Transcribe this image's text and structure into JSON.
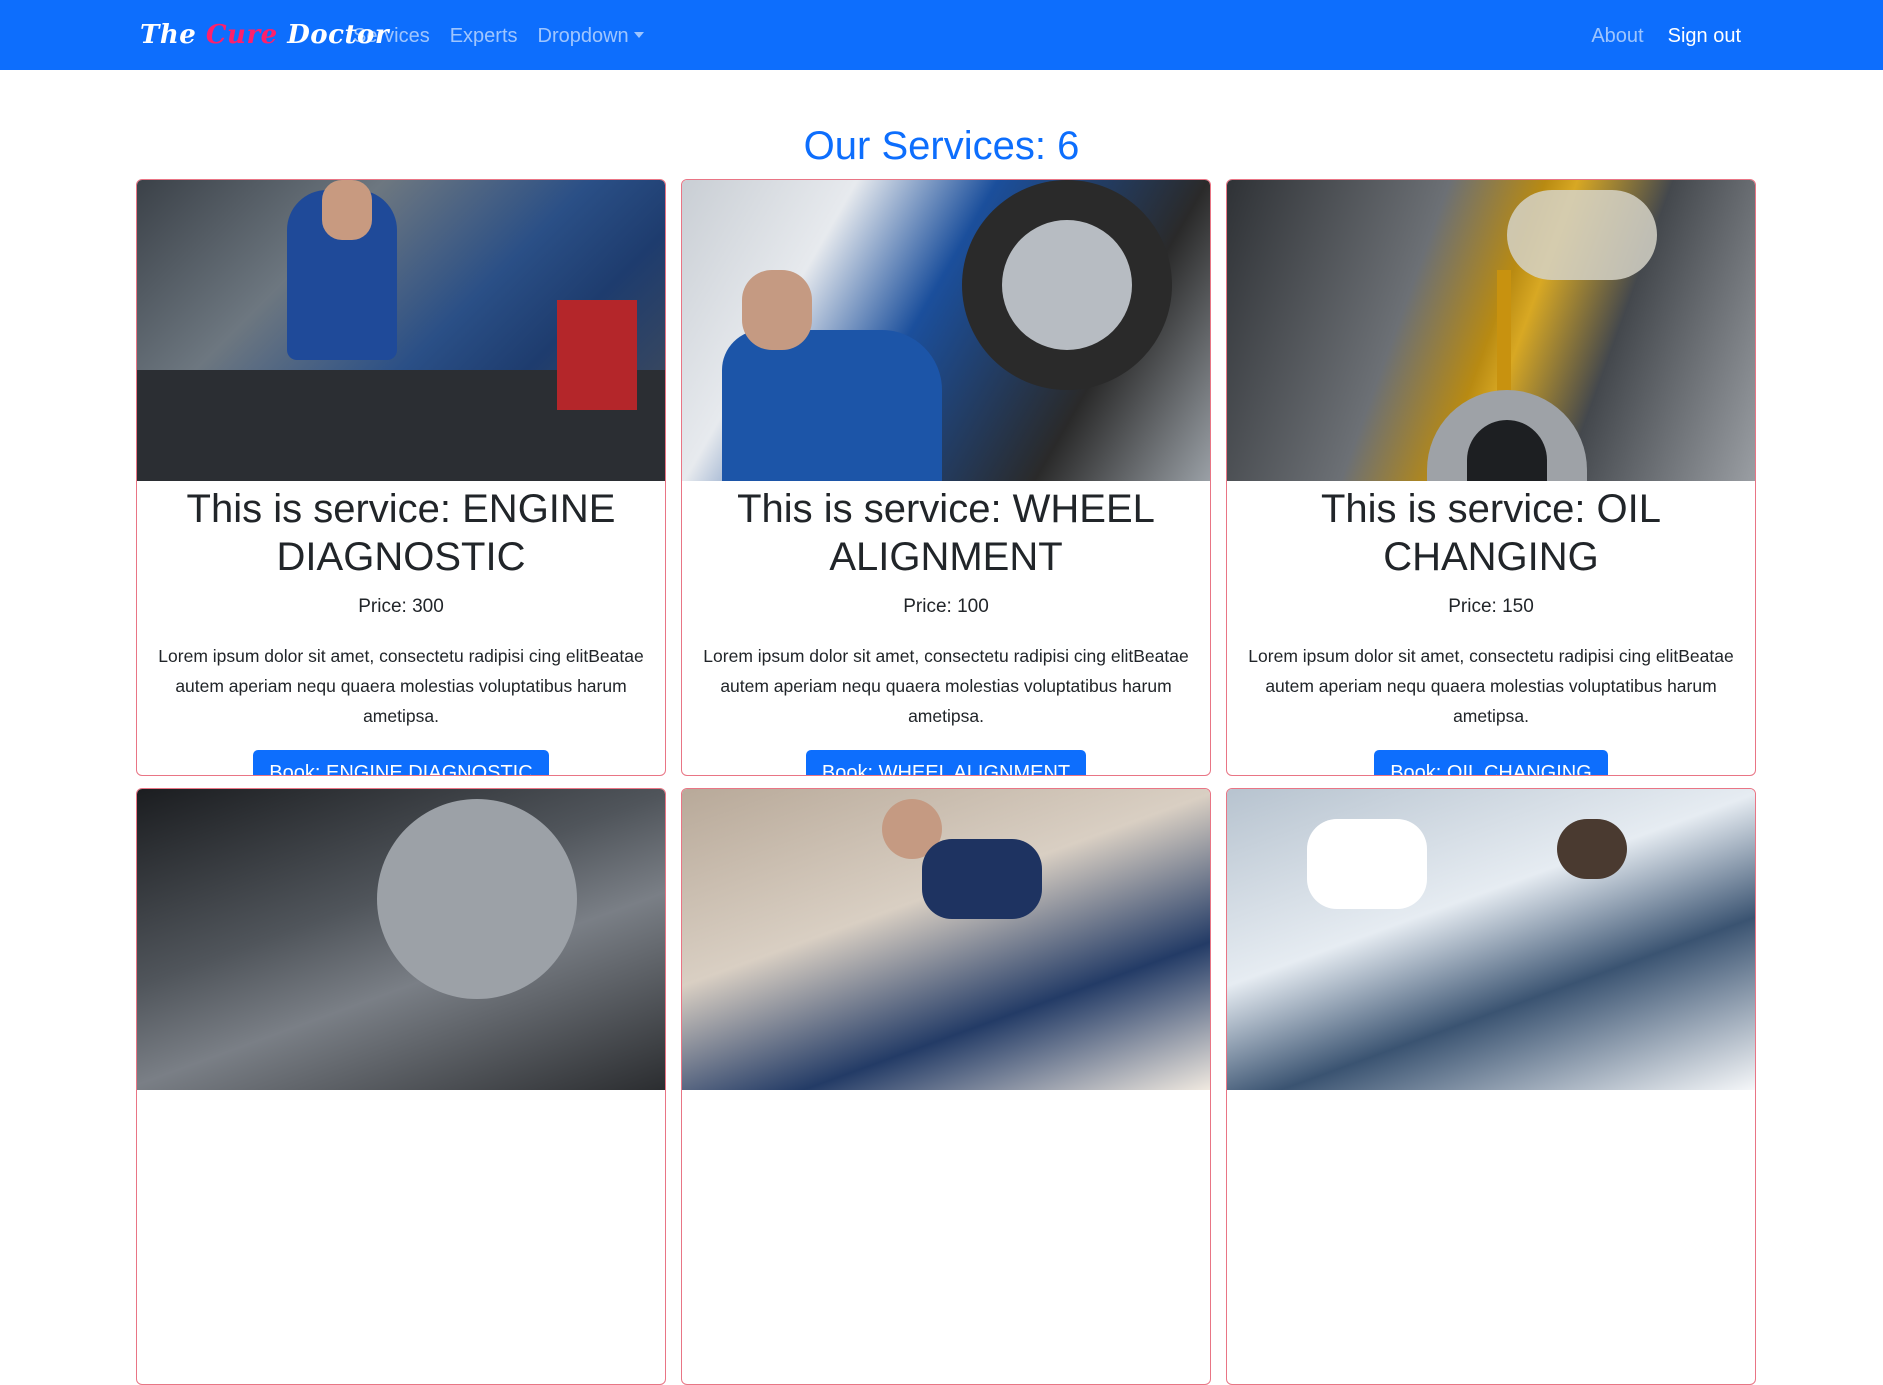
{
  "navbar": {
    "brand": {
      "part1": "The ",
      "part2": "Cure",
      "part3": " Doctor"
    },
    "left_links": [
      "Services",
      "Experts",
      "Dropdown"
    ],
    "right_links": [
      "About",
      "Sign out"
    ]
  },
  "heading": "Our Services: 6",
  "services": [
    {
      "title": "This is service: ENGINE DIAGNOSTIC",
      "price": "Price: 300",
      "description": "Lorem ipsum dolor sit amet, consectetu radipisi cing elitBeatae autem aperiam nequ quaera molestias voluptatibus harum ametipsa.",
      "button": "Book: ENGINE DIAGNOSTIC",
      "image": "mechanic-inspecting-engine"
    },
    {
      "title": "This is service: WHEEL ALIGNMENT",
      "price": "Price: 100",
      "description": "Lorem ipsum dolor sit amet, consectetu radipisi cing elitBeatae autem aperiam nequ quaera molestias voluptatibus harum ametipsa.",
      "button": "Book: WHEEL ALIGNMENT",
      "image": "mechanic-fixing-wheel"
    },
    {
      "title": "This is service: OIL CHANGING",
      "price": "Price: 150",
      "description": "Lorem ipsum dolor sit amet, consectetu radipisi cing elitBeatae autem aperiam nequ quaera molestias voluptatibus harum ametipsa.",
      "button": "Book: OIL CHANGING",
      "image": "oil-pouring-into-engine"
    },
    {
      "image": "brake-disc"
    },
    {
      "image": "mechanic-at-car"
    },
    {
      "image": "mechanics-under-hood"
    }
  ]
}
